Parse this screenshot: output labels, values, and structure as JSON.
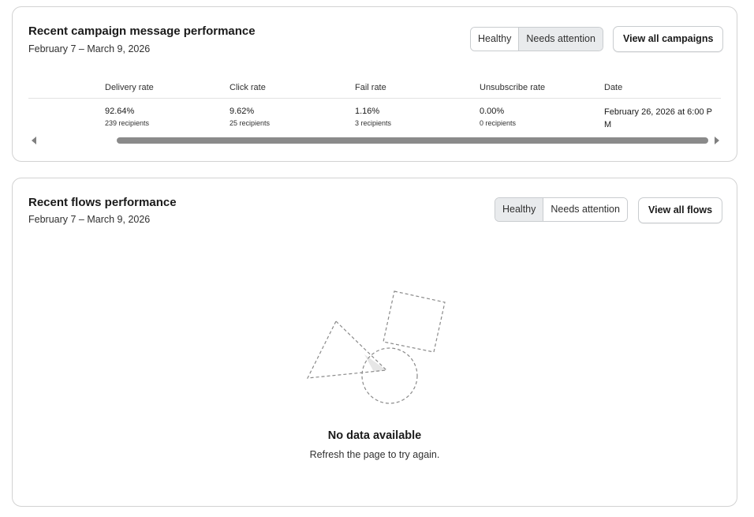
{
  "campaigns": {
    "title": "Recent campaign message performance",
    "date_range": "February 7 – March 9, 2026",
    "filters": [
      {
        "label": "Healthy",
        "active": false
      },
      {
        "label": "Needs attention",
        "active": true
      }
    ],
    "view_all_label": "View all campaigns",
    "columns": [
      "Delivery rate",
      "Click rate",
      "Fail rate",
      "Unsubscribe rate",
      "Date"
    ],
    "row": {
      "delivery_rate": "92.64%",
      "delivery_recipients": "239 recipients",
      "click_rate": "9.62%",
      "click_recipients": "25 recipients",
      "fail_rate": "1.16%",
      "fail_recipients": "3 recipients",
      "unsubscribe_rate": "0.00%",
      "unsubscribe_recipients": "0 recipients",
      "date": "February 26, 2026 at 6:00 PM"
    }
  },
  "flows": {
    "title": "Recent flows performance",
    "date_range": "February 7 – March 9, 2026",
    "filters": [
      {
        "label": "Healthy",
        "active": true
      },
      {
        "label": "Needs attention",
        "active": false
      }
    ],
    "view_all_label": "View all flows",
    "empty_title": "No data available",
    "empty_subtitle": "Refresh the page to try again."
  },
  "colors": {
    "border": "#d2d2d2",
    "active_segment": "#e9ebed",
    "scroll_thumb": "#8a8a8a"
  }
}
